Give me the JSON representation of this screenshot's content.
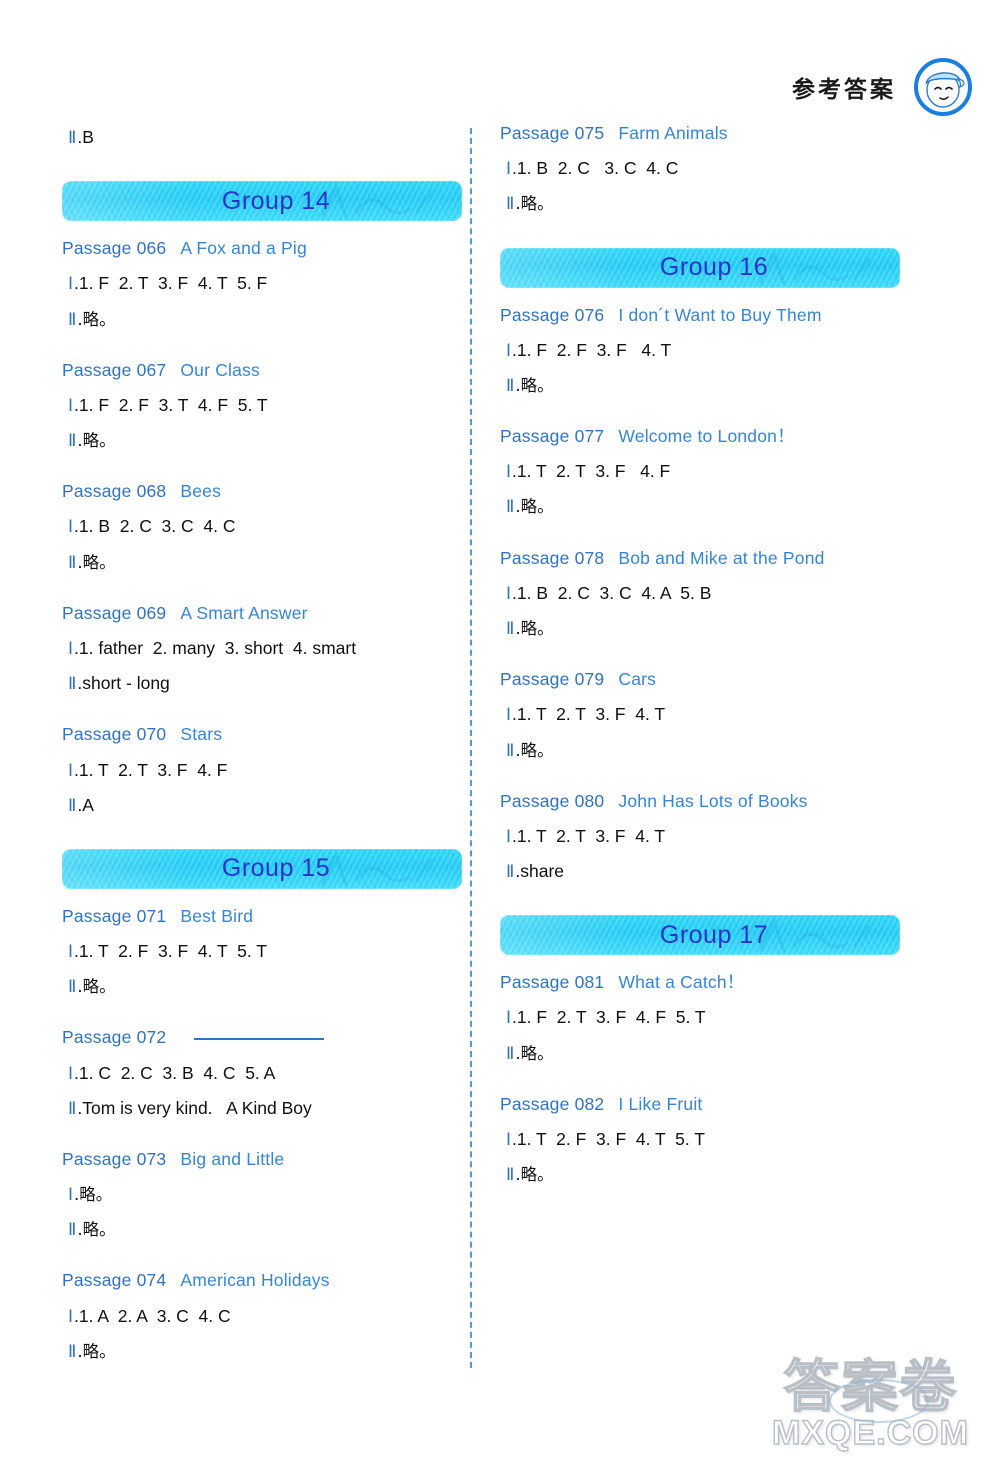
{
  "header": {
    "title": "参考答案",
    "mascot_icon": "boy-face-circle-icon"
  },
  "watermark": {
    "cjk": "答案卷",
    "domain": "MXQE.COM"
  },
  "left_column": [
    {
      "kind": "answer",
      "lines": [
        {
          "numeral": "Ⅱ",
          "text": ".B"
        }
      ]
    },
    {
      "kind": "group",
      "label": "Group 14"
    },
    {
      "kind": "passage",
      "number": "Passage 066",
      "title": "A Fox and a Pig",
      "lines": [
        {
          "numeral": "Ⅰ",
          "text": ".1. F  2. T  3. F  4. T  5. F"
        },
        {
          "numeral": "Ⅱ",
          "text": ".略。"
        }
      ]
    },
    {
      "kind": "passage",
      "number": "Passage 067",
      "title": "Our Class",
      "lines": [
        {
          "numeral": "Ⅰ",
          "text": ".1. F  2. F  3. T  4. F  5. T"
        },
        {
          "numeral": "Ⅱ",
          "text": ".略。"
        }
      ]
    },
    {
      "kind": "passage",
      "number": "Passage 068",
      "title": "Bees",
      "lines": [
        {
          "numeral": "Ⅰ",
          "text": ".1. B  2. C  3. C  4. C"
        },
        {
          "numeral": "Ⅱ",
          "text": ".略。"
        }
      ]
    },
    {
      "kind": "passage",
      "number": "Passage 069",
      "title": "A Smart Answer",
      "lines": [
        {
          "numeral": "Ⅰ",
          "text": ".1. father  2. many  3. short  4. smart"
        },
        {
          "numeral": "Ⅱ",
          "text": ".short - long"
        }
      ]
    },
    {
      "kind": "passage",
      "number": "Passage 070",
      "title": "Stars",
      "lines": [
        {
          "numeral": "Ⅰ",
          "text": ".1. T  2. T  3. F  4. F"
        },
        {
          "numeral": "Ⅱ",
          "text": ".A"
        }
      ]
    },
    {
      "kind": "group",
      "label": "Group 15"
    },
    {
      "kind": "passage",
      "number": "Passage 071",
      "title": "Best Bird",
      "lines": [
        {
          "numeral": "Ⅰ",
          "text": ".1. T  2. F  3. F  4. T  5. T"
        },
        {
          "numeral": "Ⅱ",
          "text": ".略。"
        }
      ]
    },
    {
      "kind": "passage",
      "number": "Passage 072",
      "title": "",
      "title_is_blank": true,
      "lines": [
        {
          "numeral": "Ⅰ",
          "text": ".1. C  2. C  3. B  4. C  5. A"
        },
        {
          "numeral": "Ⅱ",
          "text": ".Tom is very kind.   A Kind Boy"
        }
      ]
    },
    {
      "kind": "passage",
      "number": "Passage 073",
      "title": "Big and Little",
      "lines": [
        {
          "numeral": "Ⅰ",
          "text": ".略。"
        },
        {
          "numeral": "Ⅱ",
          "text": ".略。"
        }
      ]
    },
    {
      "kind": "passage",
      "number": "Passage 074",
      "title": "American Holidays",
      "lines": [
        {
          "numeral": "Ⅰ",
          "text": ".1. A  2. A  3. C  4. C"
        },
        {
          "numeral": "Ⅱ",
          "text": ".略。"
        }
      ]
    }
  ],
  "right_column": [
    {
      "kind": "passage",
      "number": "Passage 075",
      "title": "Farm Animals",
      "lines": [
        {
          "numeral": "Ⅰ",
          "text": ".1. B  2. C   3. C  4. C"
        },
        {
          "numeral": "Ⅱ",
          "text": ".略。"
        }
      ]
    },
    {
      "kind": "group",
      "label": "Group 16"
    },
    {
      "kind": "passage",
      "number": "Passage 076",
      "title": "I don´t Want to Buy Them",
      "lines": [
        {
          "numeral": "Ⅰ",
          "text": ".1. F  2. F  3. F   4. T"
        },
        {
          "numeral": "Ⅱ",
          "text": ".略。"
        }
      ]
    },
    {
      "kind": "passage",
      "number": "Passage 077",
      "title": "Welcome to London！",
      "lines": [
        {
          "numeral": "Ⅰ",
          "text": ".1. T  2. T  3. F   4. F"
        },
        {
          "numeral": "Ⅱ",
          "text": ".略。"
        }
      ]
    },
    {
      "kind": "passage",
      "number": "Passage 078",
      "title": "Bob and Mike at the Pond",
      "lines": [
        {
          "numeral": "Ⅰ",
          "text": ".1. B  2. C  3. C  4. A  5. B"
        },
        {
          "numeral": "Ⅱ",
          "text": ".略。"
        }
      ]
    },
    {
      "kind": "passage",
      "number": "Passage 079",
      "title": "Cars",
      "lines": [
        {
          "numeral": "Ⅰ",
          "text": ".1. T  2. T  3. F  4. T"
        },
        {
          "numeral": "Ⅱ",
          "text": ".略。"
        }
      ]
    },
    {
      "kind": "passage",
      "number": "Passage 080",
      "title": "John Has Lots of Books",
      "lines": [
        {
          "numeral": "Ⅰ",
          "text": ".1. T  2. T  3. F  4. T"
        },
        {
          "numeral": "Ⅱ",
          "text": ".share"
        }
      ]
    },
    {
      "kind": "group",
      "label": "Group 17"
    },
    {
      "kind": "passage",
      "number": "Passage 081",
      "title": "What a Catch！",
      "lines": [
        {
          "numeral": "Ⅰ",
          "text": ".1. F  2. T  3. F  4. F  5. T"
        },
        {
          "numeral": "Ⅱ",
          "text": ".略。"
        }
      ]
    },
    {
      "kind": "passage",
      "number": "Passage 082",
      "title": "I Like Fruit",
      "lines": [
        {
          "numeral": "Ⅰ",
          "text": ".1. T  2. F  3. F  4. T  5. T"
        },
        {
          "numeral": "Ⅱ",
          "text": ".略。"
        }
      ]
    }
  ],
  "colors": {
    "heading_blue": "#2f73c4",
    "title_blue": "#3486d6",
    "group_band_cyan": "#2fd6f7",
    "group_text_blue": "#2a34c8",
    "answer_black": "#111111",
    "divider_blue": "#2d8fd0"
  }
}
